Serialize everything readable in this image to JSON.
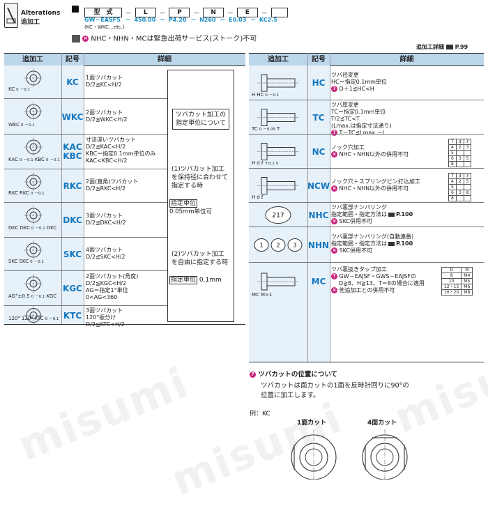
{
  "header": {
    "alterations_en": "Alterations",
    "alterations_jp": "追加工",
    "type_label": "型　式",
    "part_boxes": [
      "型　式",
      "L",
      "P",
      "N",
      "E"
    ],
    "suffix": "(KC・WKC…etc.)",
    "example_values": [
      "GW－EASF5",
      "450.00",
      "P4.20",
      "N260",
      "E0.03",
      "KC2.5"
    ],
    "dashes": [
      "－",
      "－",
      "－",
      "－",
      "－"
    ],
    "notice": "NHC・NHN・MCは緊急出荷サービス(ストーク)不可",
    "detail_link": "追加工詳細",
    "detail_page": "P.99"
  },
  "left_table": {
    "columns": [
      "追加工",
      "記号",
      "詳細"
    ],
    "rows": [
      {
        "code": "KC",
        "lines": [
          "1面ツバカット",
          "D/2≦KC<H/2"
        ],
        "dims": [
          "KC",
          "0",
          "－0.1"
        ]
      },
      {
        "code": "WKC",
        "lines": [
          "2面ツバカット",
          "D/2≦WKC<H/2"
        ],
        "dims": [
          "WKC",
          "0",
          "－0.1"
        ]
      },
      {
        "code": "KAC\nKBC",
        "code1": "KAC",
        "code2": "KBC",
        "lines": [
          "寸法違いツバカット",
          "D/2≦KAC<H/2",
          "KBC＝指定0.1mm単位のみ",
          "KAC<KBC<H/2"
        ],
        "dims": [
          "KAC",
          "0",
          "－0.1",
          "KBC",
          "0",
          "－0.1"
        ]
      },
      {
        "code": "RKC",
        "lines": [
          "2面(直角)ツバカット",
          "D/2≦RKC<H/2"
        ],
        "dims": [
          "RKC",
          "RKC",
          "0",
          "－0.1"
        ]
      },
      {
        "code": "DKC",
        "lines": [
          "3面ツバカット",
          "D/2≦DKC<H/2"
        ],
        "dims": [
          "DKC",
          "DKC",
          "0",
          "－0.1",
          "DKC"
        ]
      },
      {
        "code": "SKC",
        "lines": [
          "4面ツバカット",
          "D/2≦SKC<H/2"
        ],
        "dims": [
          "SKC",
          "SKC",
          "0",
          "－0.1"
        ]
      },
      {
        "code": "KGC",
        "lines": [
          "2面ツバカット(角度)",
          "D/2≦KGC<H/2",
          "AG＝指定1°単位",
          "0<AG<360"
        ],
        "dims": [
          "AG°±0.5",
          "0",
          "－0.1",
          "KGC"
        ]
      },
      {
        "code": "KTC",
        "lines": [
          "3面ツバカット",
          "120°振分け",
          "D/2≦KTC<H/2"
        ],
        "dims": [
          "120°",
          "120°",
          "KTC",
          "0",
          "－0.1"
        ]
      }
    ],
    "unit_note": {
      "title": "ツバカット加工の指定単位について",
      "case1": "(1)ツバカット加工を保持径に合わせて指定する時",
      "case1_unit_label": "指定単位",
      "case1_unit": "0.05mm単位可",
      "case2": "(2)ツバカット加工を自由に指定する時",
      "case2_unit_label": "指定単位",
      "case2_unit": "0.1mm"
    }
  },
  "right_table": {
    "columns": [
      "追加工",
      "記号",
      "詳細"
    ],
    "rows": [
      {
        "code": "HC",
        "lines": [
          "ツバ径変更",
          "HC＝指定0.1mm単位"
        ],
        "tip": "D＋1≦HC<H",
        "dims": [
          "H",
          "HC",
          "0",
          "－0.1"
        ]
      },
      {
        "code": "TC",
        "lines": [
          "ツバ厚変更",
          "TC＝指定0.1mm単位",
          "T/2≦TC<T",
          "(Lmax.は指定寸法通り)"
        ],
        "tip": "T－TC≦Lmax.－L",
        "dims": [
          "TC",
          "0",
          "－0.05",
          "T"
        ]
      },
      {
        "code": "NC",
        "lines": [
          "ノック穴加工"
        ],
        "x": "NHC・NHN以外の併用不可",
        "dims": [
          "H",
          "d",
          "ℓ",
          "＋0.1",
          "0"
        ],
        "table": {
          "head": [
            "T",
            "d",
            "ℓ"
          ],
          "rows": [
            [
              "4",
              "2",
              "3"
            ],
            [
              "5",
              "",
              ""
            ],
            [
              "6",
              "3",
              "5"
            ],
            [
              "8",
              "",
              ""
            ]
          ]
        }
      },
      {
        "code": "NCW",
        "lines": [
          "ノック穴＋スプリングピン打込加工"
        ],
        "x": "NHC・NHN以外の併用不可",
        "dims": [
          "H",
          "d",
          "ℓ"
        ],
        "table": {
          "head": [
            "T",
            "d",
            "ℓ"
          ],
          "rows": [
            [
              "4",
              "2",
              "5"
            ],
            [
              "5",
              "",
              ""
            ],
            [
              "6",
              "3",
              "8"
            ],
            [
              "8",
              "",
              ""
            ]
          ]
        }
      },
      {
        "code": "NHC",
        "lines": [
          "ツバ裏部ナンバリング",
          "指定範囲・指定方法は"
        ],
        "link": "P.100",
        "x": "SKC併用不可",
        "dims": [
          "217"
        ]
      },
      {
        "code": "NHN",
        "lines": [
          "ツバ裏部ナンバリング(自動連番)",
          "指定範囲・指定方法は"
        ],
        "link": "P.100",
        "x": "SKC併用不可",
        "dims": [
          "1",
          "2",
          "3"
        ]
      },
      {
        "code": "MC",
        "lines": [
          "ツバ裏抜きタップ加工"
        ],
        "tip": "GW－EAJSF・GWS－EAJSFの",
        "tip2": "D≧8、H≧13、T＝8の場合に適用",
        "x": "他追加工との併用不可",
        "dims": [
          "MC",
          "M×1"
        ],
        "table": {
          "head": [
            "D",
            "M"
          ],
          "rows": [
            [
              "8",
              "M4"
            ],
            [
              "10",
              "M5"
            ],
            [
              "12・15",
              "M6"
            ],
            [
              "16・20",
              "M8"
            ]
          ]
        }
      }
    ]
  },
  "position_note": {
    "title": "ツバカットの位置について",
    "text1": "ツバカットは面カットの1面を反時計回りに90°の",
    "text2": "位置に加工します。",
    "example": "例：KC",
    "label1": "1面カット",
    "label2": "4面カット"
  },
  "watermark": "misumi",
  "colors": {
    "accent": "#1577bf",
    "header_bg": "#bcd7ea",
    "cell_bg": "#e6f1fa",
    "mark": "#c8247b"
  }
}
